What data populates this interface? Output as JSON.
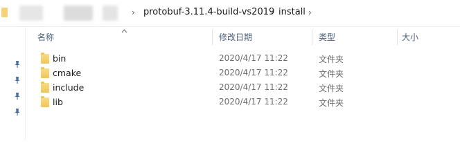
{
  "breadcrumb": {
    "items": [
      "protobuf-3.11.4-build-vs2019",
      "install"
    ]
  },
  "columns": {
    "name": "名称",
    "date": "修改日期",
    "type": "类型",
    "size": "大小"
  },
  "files": [
    {
      "name": "bin",
      "date": "2020/4/17 11:22",
      "type": "文件夹"
    },
    {
      "name": "cmake",
      "date": "2020/4/17 11:22",
      "type": "文件夹"
    },
    {
      "name": "include",
      "date": "2020/4/17 11:22",
      "type": "文件夹"
    },
    {
      "name": "lib",
      "date": "2020/4/17 11:22",
      "type": "文件夹"
    }
  ],
  "colors": {
    "folder": "#f0c557",
    "header_text": "#4c5e7a",
    "pin": "#4a6fa5"
  },
  "icons": [
    "folder-icon",
    "chevron-right-icon",
    "pin-icon",
    "sort-ascending-icon"
  ]
}
